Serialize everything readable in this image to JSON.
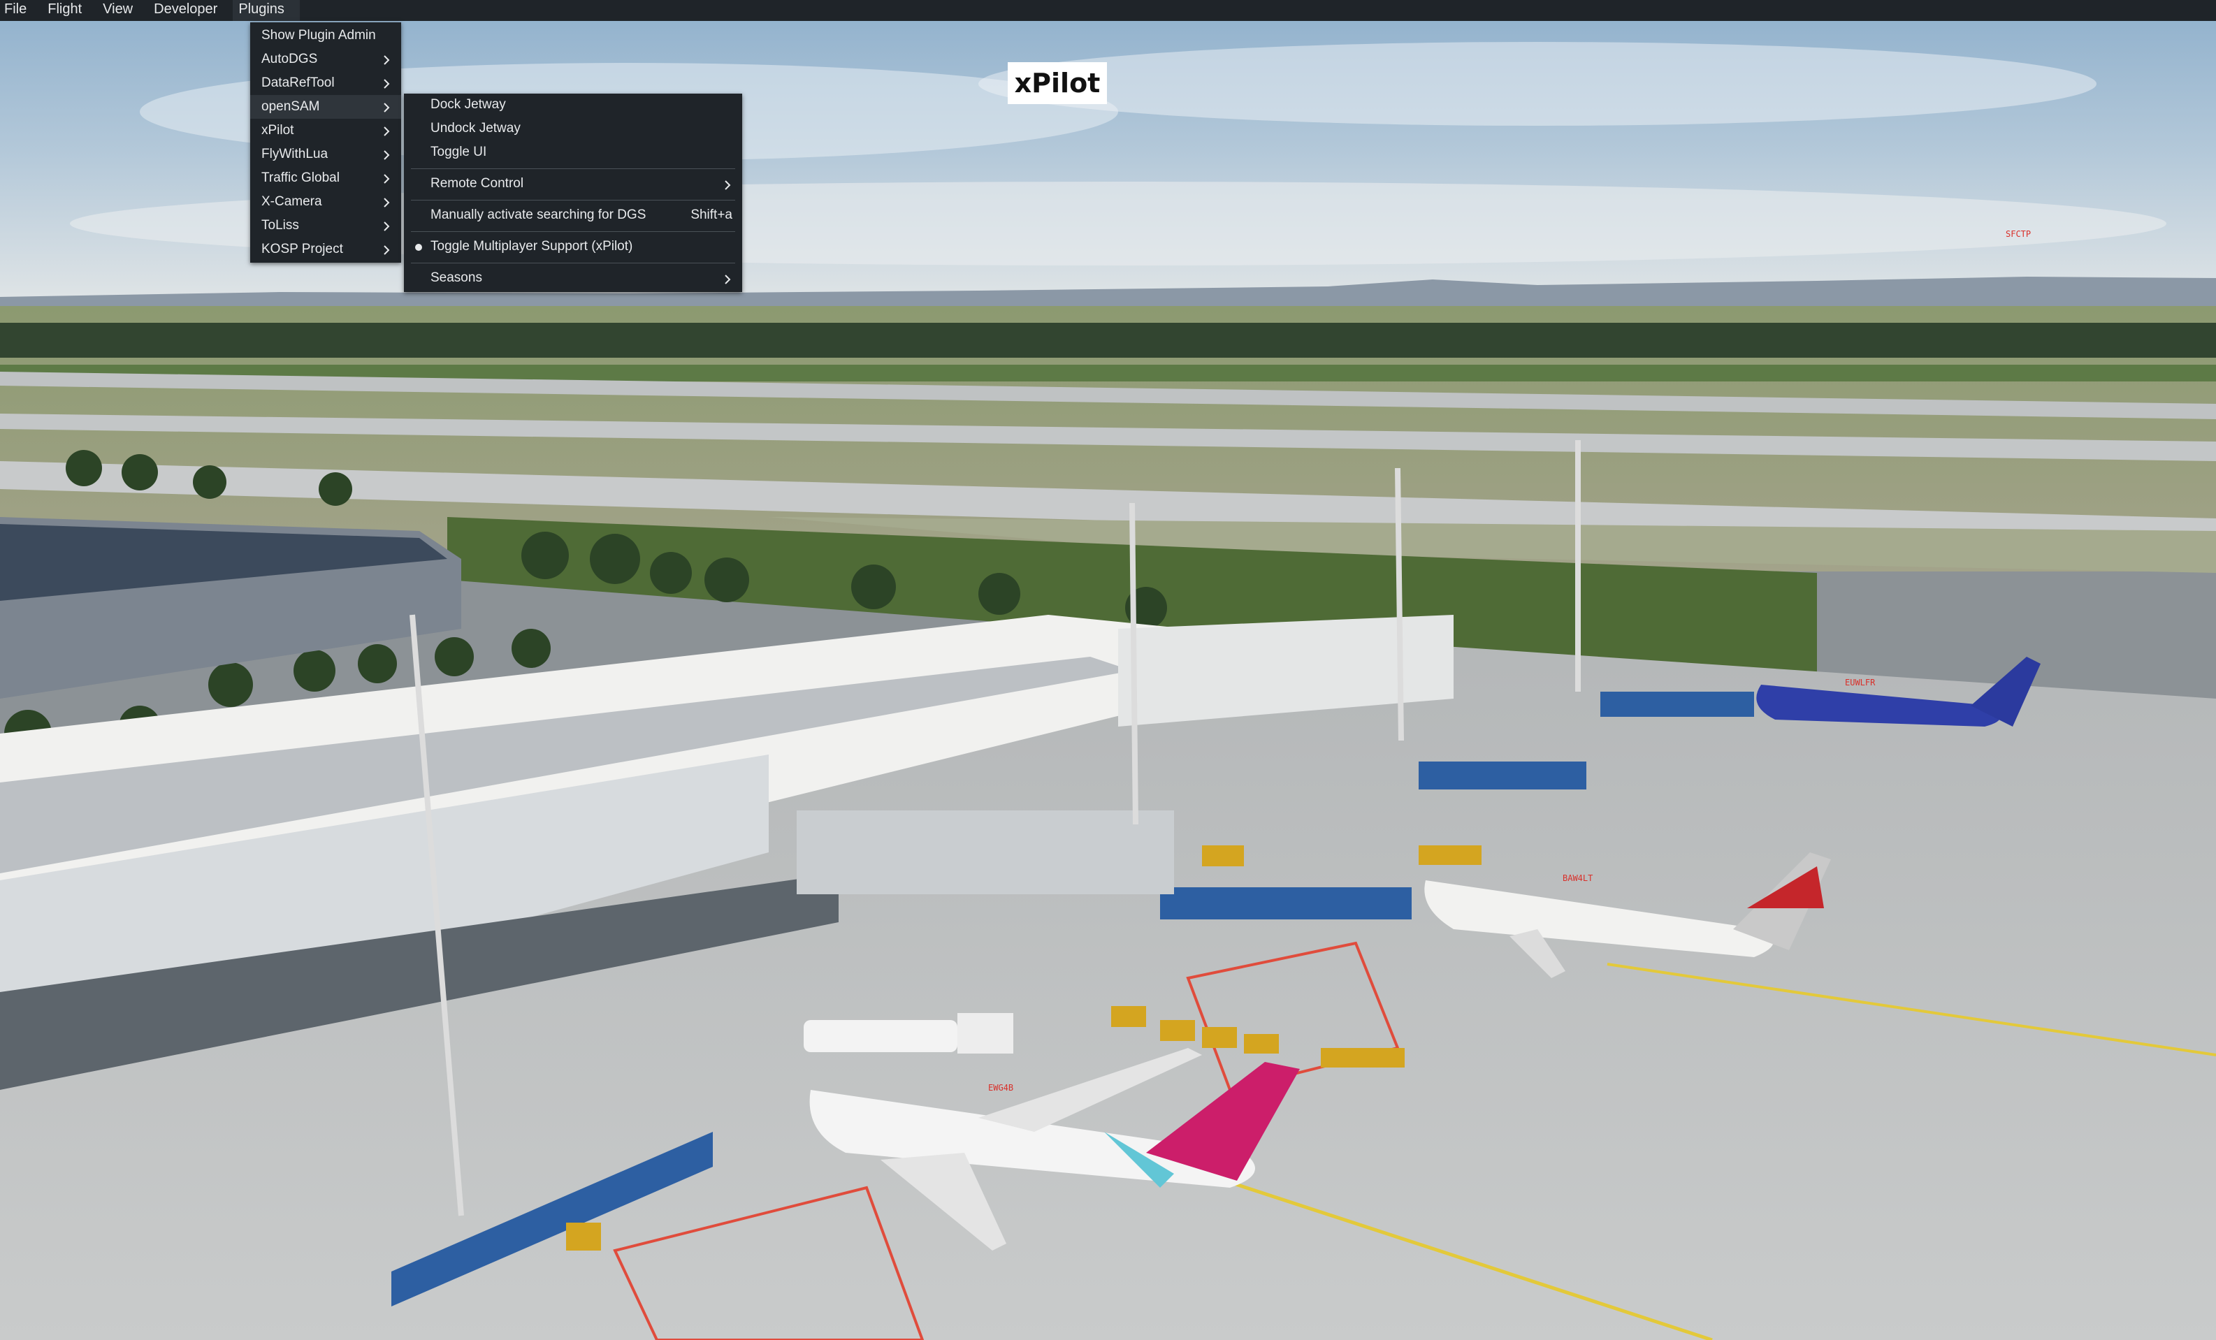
{
  "menubar": {
    "items": [
      "File",
      "Flight",
      "View",
      "Developer",
      "Plugins"
    ]
  },
  "plugins_menu": {
    "items": [
      {
        "label": "Show Plugin Admin",
        "submenu": false
      },
      {
        "label": "AutoDGS",
        "submenu": true
      },
      {
        "label": "DataRefTool",
        "submenu": true
      },
      {
        "label": "openSAM",
        "submenu": true
      },
      {
        "label": "xPilot",
        "submenu": true
      },
      {
        "label": "FlyWithLua",
        "submenu": true
      },
      {
        "label": "Traffic Global",
        "submenu": true
      },
      {
        "label": "X-Camera",
        "submenu": true
      },
      {
        "label": "ToLiss",
        "submenu": true
      },
      {
        "label": "KOSP Project",
        "submenu": true
      }
    ]
  },
  "submenu": {
    "dock": "Dock Jetway",
    "undock": "Undock Jetway",
    "toggle_ui": "Toggle UI",
    "remote_control": "Remote Control",
    "manual_dgs": "Manually activate searching for DGS",
    "manual_dgs_shortcut": "Shift+a",
    "toggle_multiplayer": "Toggle Multiplayer Support (xPilot)",
    "seasons": "Seasons"
  },
  "overlay": {
    "xpilot_label": "xPilot",
    "callsigns": [
      "SFCTP",
      "EUWLFR",
      "BAW4LT",
      "EWG4B"
    ]
  },
  "colors": {
    "menu_bg": "#1f2429",
    "menu_text": "#e8eaec",
    "callsign_red": "#d9302a"
  }
}
